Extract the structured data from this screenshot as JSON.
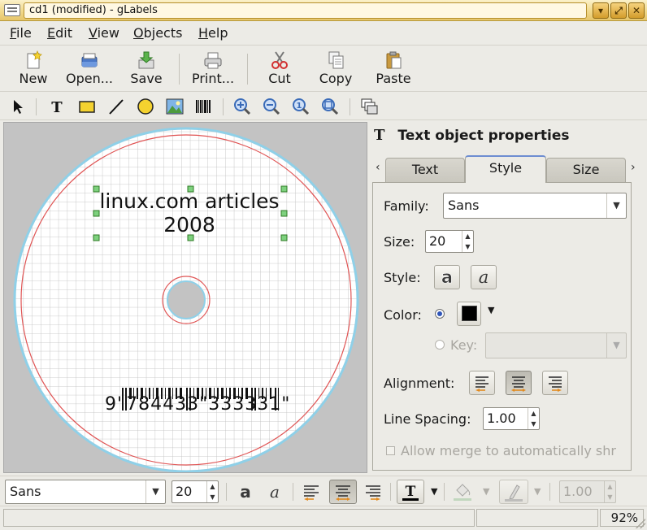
{
  "window": {
    "title": "cd1 (modified) - gLabels"
  },
  "menu": {
    "items": [
      "File",
      "Edit",
      "View",
      "Objects",
      "Help"
    ]
  },
  "toolbar": {
    "new": "New",
    "open": "Open...",
    "save": "Save",
    "print": "Print...",
    "cut": "Cut",
    "copy": "Copy",
    "paste": "Paste"
  },
  "drawing_tools": [
    "select-arrow-icon",
    "text-tool-icon",
    "box-tool-icon",
    "line-tool-icon",
    "ellipse-tool-icon",
    "image-tool-icon",
    "barcode-tool-icon",
    "zoom-in-icon",
    "zoom-out-icon",
    "zoom-one-to-one-icon",
    "zoom-to-fit-icon",
    "merge-properties-icon"
  ],
  "label": {
    "text_line1": "linux.com articles",
    "text_line2": "2008",
    "barcode_digits": "9\"784433\"333331\""
  },
  "props": {
    "title": "Text object properties",
    "title_glyph": "T",
    "tabs": [
      "Text",
      "Style",
      "Size"
    ],
    "active_tab": "Style",
    "family_label": "Family:",
    "family_value": "Sans",
    "size_label": "Size:",
    "size_value": "20",
    "style_label": "Style:",
    "bold_glyph": "a",
    "italic_glyph": "a",
    "color_label": "Color:",
    "color_value": "#000000",
    "key_label": "Key:",
    "alignment_label": "Alignment:",
    "alignment_selected": "center",
    "line_spacing_label": "Line Spacing:",
    "line_spacing_value": "1.00",
    "merge_label": "Allow merge to automatically shr"
  },
  "format_bar": {
    "font_family": "Sans",
    "font_size": "20",
    "text_color_glyph": "T",
    "line_width": "1.00"
  },
  "status": {
    "zoom": "92%"
  },
  "colors": {
    "title_bar": "#f1d98c",
    "accent": "#6d8dd1",
    "canvas_bg": "#c3c3c3",
    "safe_area": "#e05555",
    "disc_outline": "#8fd0e8",
    "selection_handle": "#3aa83a"
  }
}
